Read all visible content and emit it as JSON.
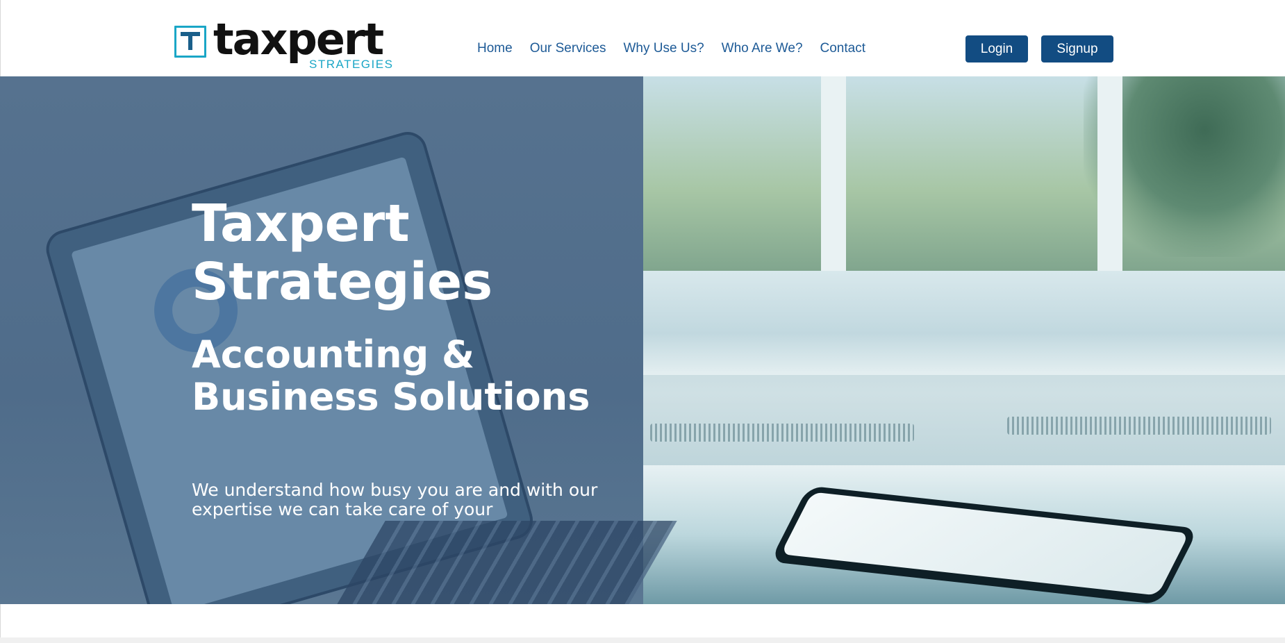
{
  "brand": {
    "wordmark": "taxpert",
    "tagline": "STRATEGIES",
    "colors": {
      "primary": "#124c82",
      "accent": "#1aa6c6",
      "nav_text": "#1d5a96"
    }
  },
  "nav": {
    "items": [
      {
        "label": "Home"
      },
      {
        "label": "Our Services"
      },
      {
        "label": "Why Use Us?"
      },
      {
        "label": "Who Are We?"
      },
      {
        "label": "Contact"
      }
    ]
  },
  "auth": {
    "login_label": "Login",
    "signup_label": "Signup"
  },
  "hero": {
    "title": "Taxpert Strategies",
    "subtitle": "Accounting & Business Solutions",
    "description": "We understand how busy you are and with our expertise we can take care of your"
  }
}
